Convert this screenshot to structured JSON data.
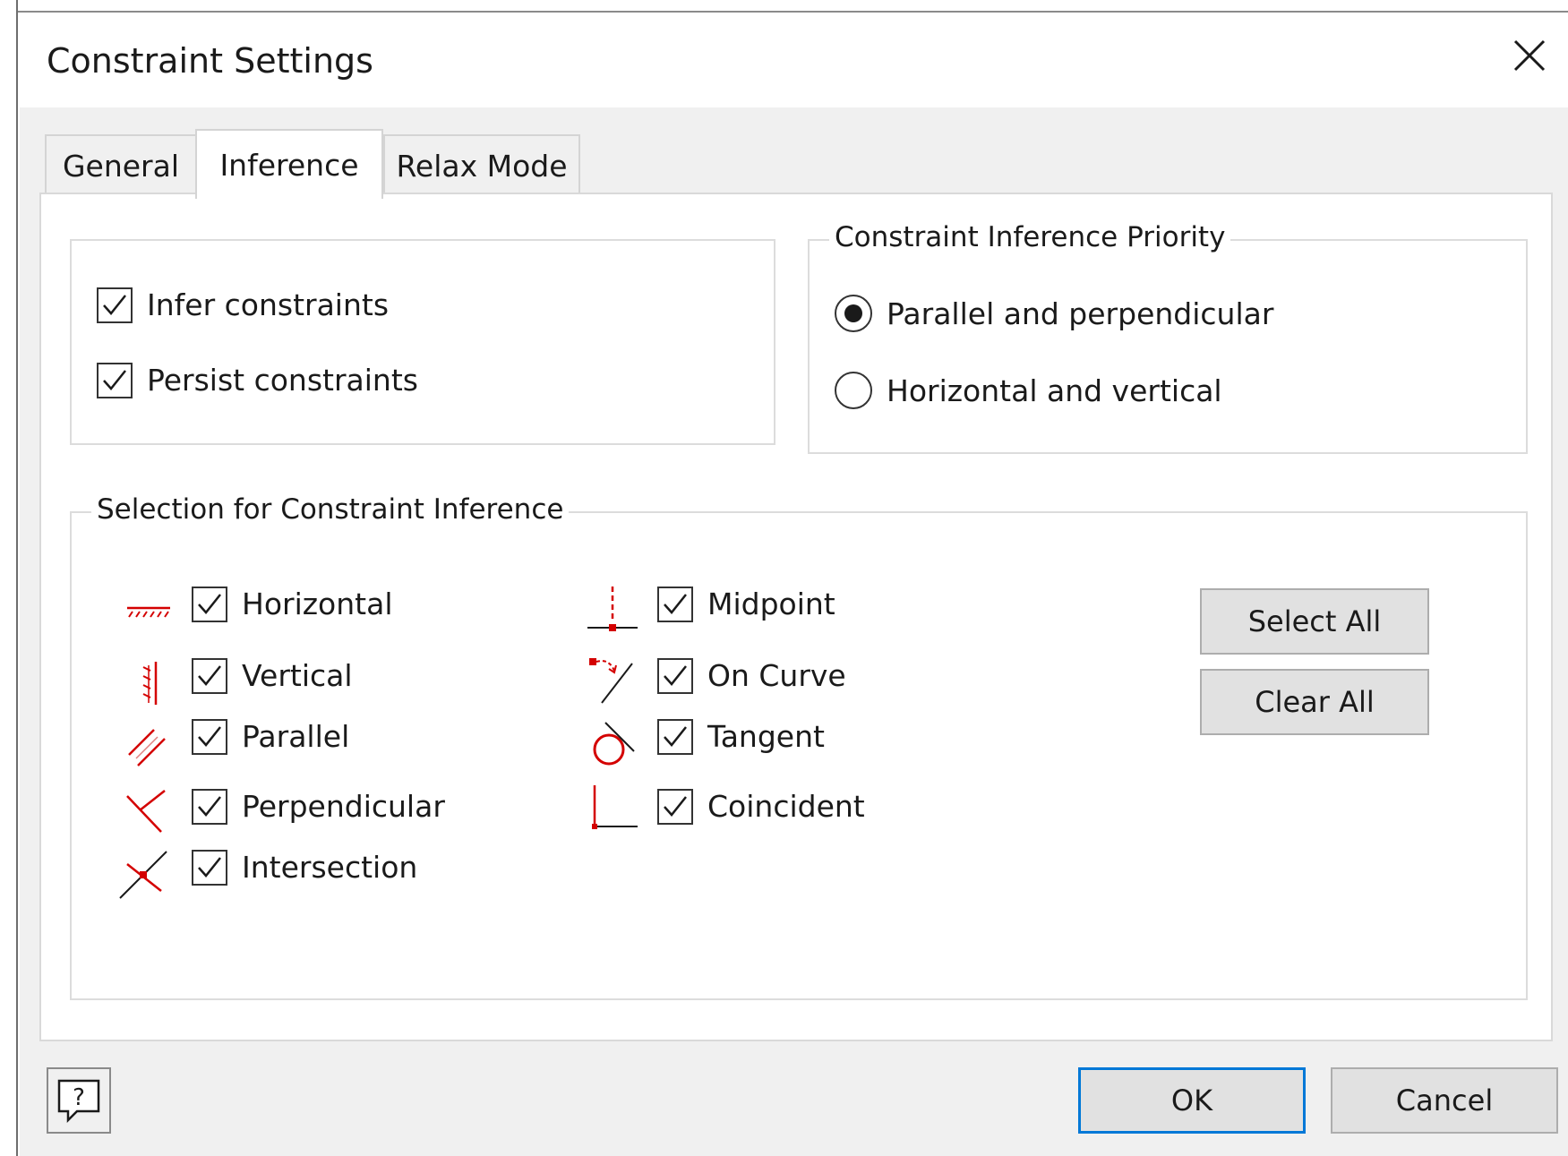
{
  "window": {
    "title": "Constraint Settings"
  },
  "tabs": [
    {
      "label": "General",
      "active": false
    },
    {
      "label": "Inference",
      "active": true
    },
    {
      "label": "Relax Mode",
      "active": false
    }
  ],
  "options": {
    "infer_constraints": {
      "label": "Infer constraints",
      "checked": true
    },
    "persist_constraints": {
      "label": "Persist constraints",
      "checked": true
    }
  },
  "priority": {
    "legend": "Constraint Inference Priority",
    "options": [
      {
        "label": "Parallel and perpendicular",
        "selected": true
      },
      {
        "label": "Horizontal and vertical",
        "selected": false
      }
    ]
  },
  "selection": {
    "legend": "Selection for Constraint Inference",
    "items": [
      {
        "label": "Horizontal",
        "icon": "horizontal-constraint-icon",
        "checked": true
      },
      {
        "label": "Vertical",
        "icon": "vertical-constraint-icon",
        "checked": true
      },
      {
        "label": "Parallel",
        "icon": "parallel-constraint-icon",
        "checked": true
      },
      {
        "label": "Perpendicular",
        "icon": "perpendicular-constraint-icon",
        "checked": true
      },
      {
        "label": "Intersection",
        "icon": "intersection-constraint-icon",
        "checked": true
      },
      {
        "label": "Midpoint",
        "icon": "midpoint-constraint-icon",
        "checked": true
      },
      {
        "label": "On Curve",
        "icon": "on-curve-constraint-icon",
        "checked": true
      },
      {
        "label": "Tangent",
        "icon": "tangent-constraint-icon",
        "checked": true
      },
      {
        "label": "Coincident",
        "icon": "coincident-constraint-icon",
        "checked": true
      }
    ],
    "select_all_label": "Select All",
    "clear_all_label": "Clear All"
  },
  "footer": {
    "ok_label": "OK",
    "cancel_label": "Cancel",
    "help_icon": "help-icon"
  },
  "colors": {
    "accent": "#0078d7",
    "icon_red": "#d40000",
    "dialog_bg": "#f0f0f0"
  }
}
